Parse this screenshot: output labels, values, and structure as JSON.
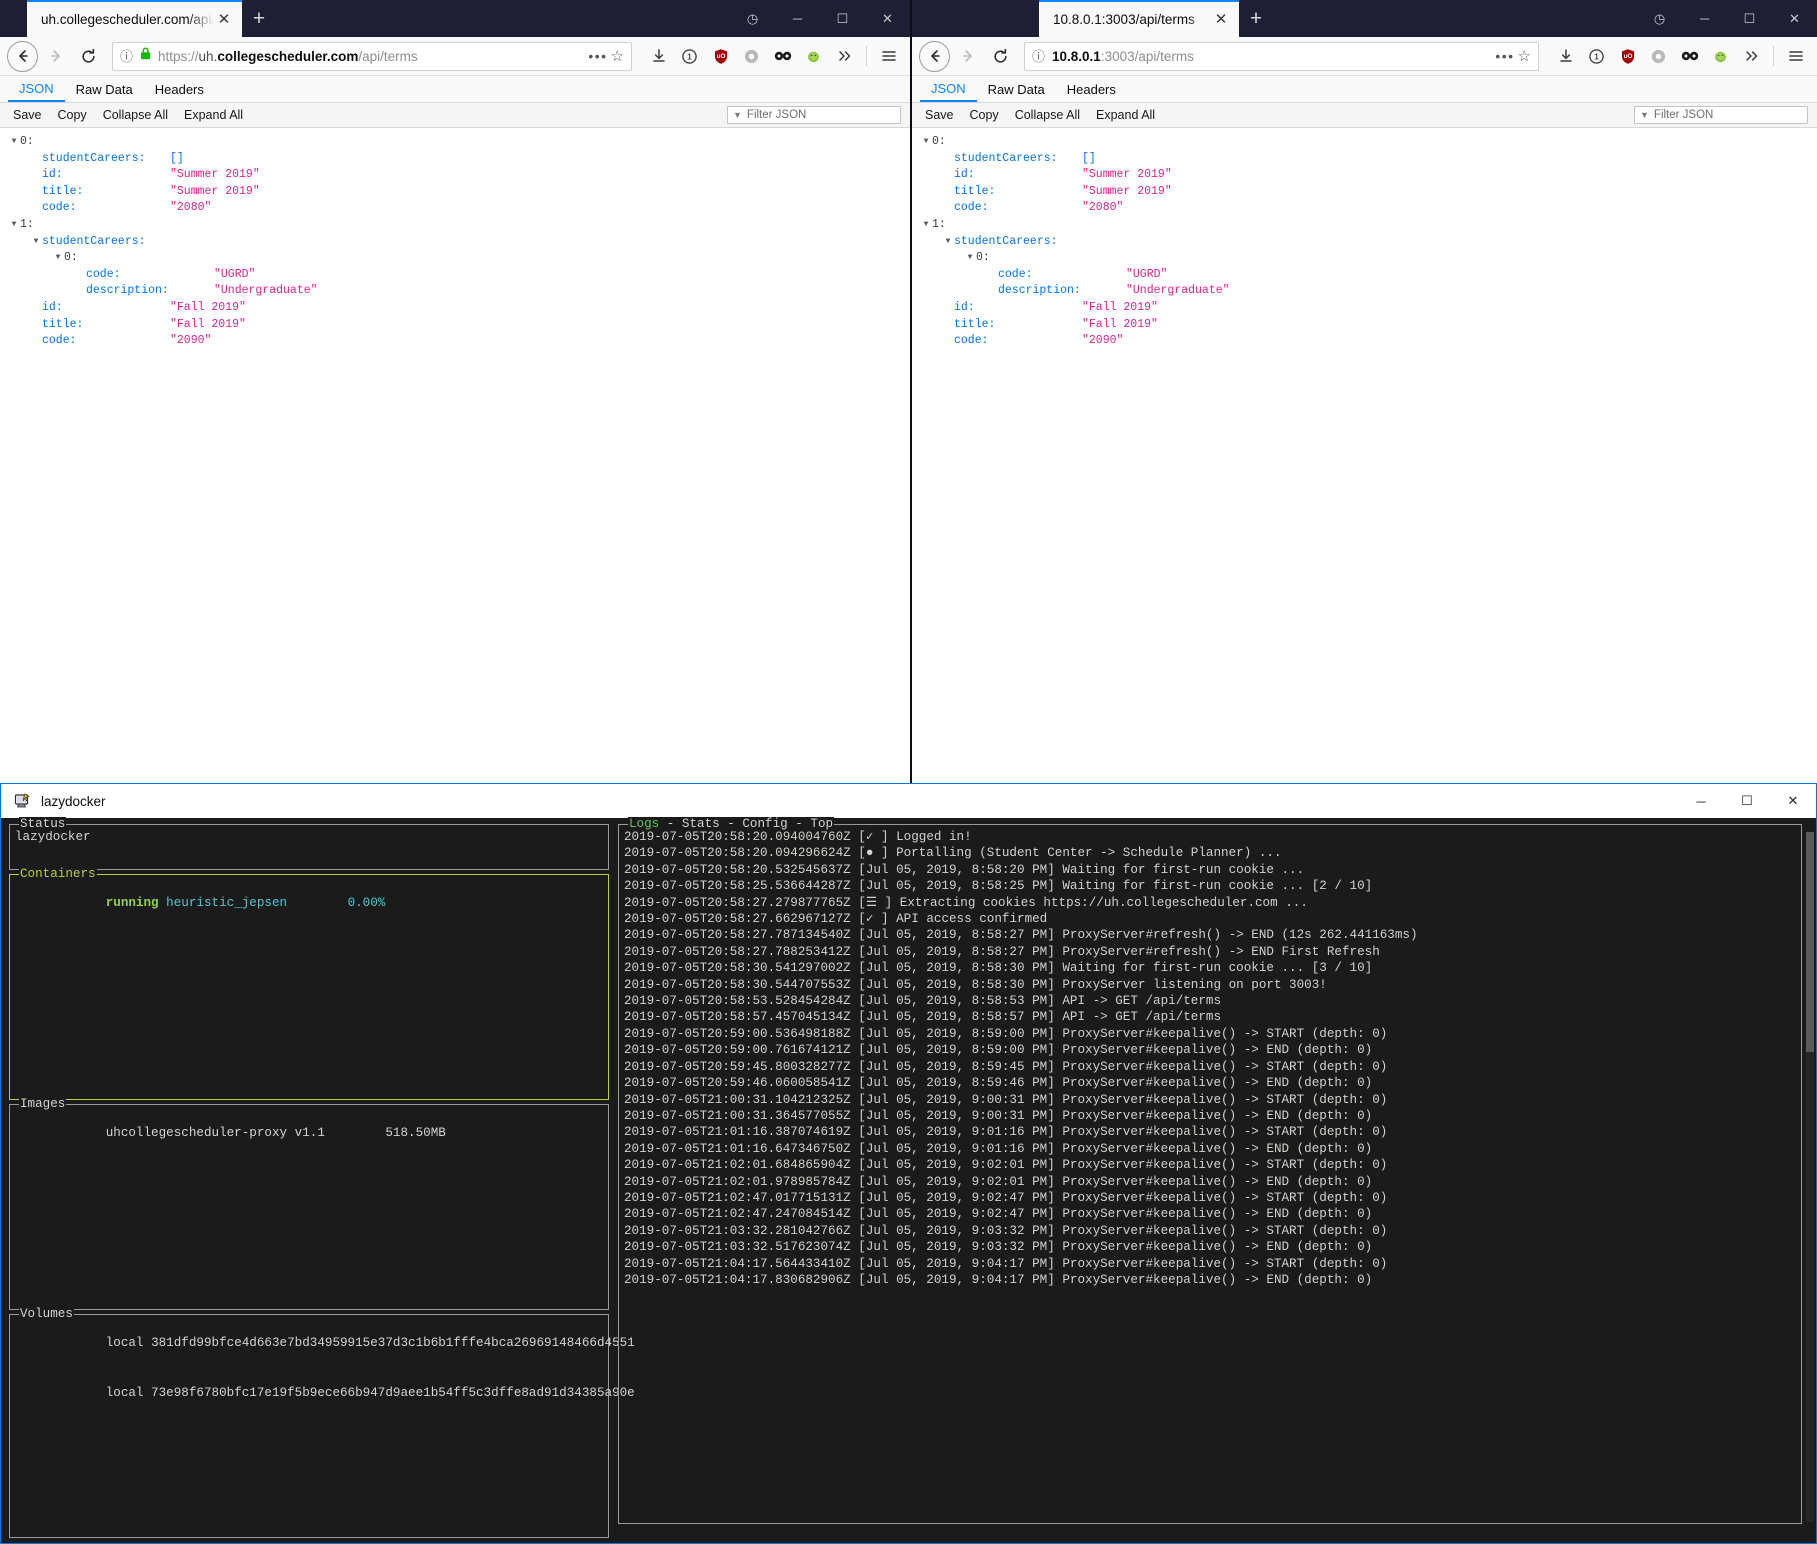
{
  "browser_left": {
    "tab": {
      "title": "uh.collegescheduler.com/api/terms",
      "close_label": "✕"
    },
    "new_tab_label": "+",
    "window_controls": {
      "clock": "◷",
      "minimize": "─",
      "maximize": "☐",
      "close": "✕"
    },
    "nav": {
      "back": "←",
      "forward": "→",
      "reload": "⟳"
    },
    "url": {
      "scheme": "https://",
      "host_dim": "uh.",
      "host_strong": "collegescheduler.com",
      "path": "/api/terms",
      "full": "https://uh.collegescheduler.com/api/terms"
    },
    "urlbar_icons": {
      "info": "ⓘ",
      "lock": "lock-icon",
      "more": "•••",
      "bookmark": "☆"
    },
    "toolbar_icons": [
      "download-icon",
      "pocket-icon",
      "ublock-origin-icon",
      "privacy-badger-icon",
      "cookie-autodelete-icon",
      "greenshot-icon",
      "overflow-icon",
      "hamburger-menu-icon"
    ],
    "json_tabs": [
      {
        "label": "JSON",
        "active": true
      },
      {
        "label": "Raw Data",
        "active": false
      },
      {
        "label": "Headers",
        "active": false
      }
    ],
    "json_toolbar": {
      "save": "Save",
      "copy": "Copy",
      "collapse_all": "Collapse All",
      "expand_all": "Expand All",
      "filter_placeholder": "Filter JSON",
      "filter_value": ""
    },
    "json_rows": [
      {
        "indent": 0,
        "twisty": "▼",
        "key": "0:",
        "key_type": "index",
        "value": ""
      },
      {
        "indent": 1,
        "twisty": "",
        "key": "studentCareers:",
        "key_type": "key",
        "value": "[]",
        "value_type": "empty"
      },
      {
        "indent": 1,
        "twisty": "",
        "key": "id:",
        "key_type": "key",
        "value": "\"Summer 2019\""
      },
      {
        "indent": 1,
        "twisty": "",
        "key": "title:",
        "key_type": "key",
        "value": "\"Summer 2019\""
      },
      {
        "indent": 1,
        "twisty": "",
        "key": "code:",
        "key_type": "key",
        "value": "\"2080\""
      },
      {
        "indent": 0,
        "twisty": "▼",
        "key": "1:",
        "key_type": "index",
        "value": ""
      },
      {
        "indent": 1,
        "twisty": "▼",
        "key": "studentCareers:",
        "key_type": "key",
        "value": ""
      },
      {
        "indent": 2,
        "twisty": "▼",
        "key": "0:",
        "key_type": "index",
        "value": ""
      },
      {
        "indent": 3,
        "twisty": "",
        "key": "code:",
        "key_type": "key",
        "value": "\"UGRD\""
      },
      {
        "indent": 3,
        "twisty": "",
        "key": "description:",
        "key_type": "key",
        "value": "\"Undergraduate\""
      },
      {
        "indent": 1,
        "twisty": "",
        "key": "id:",
        "key_type": "key",
        "value": "\"Fall 2019\""
      },
      {
        "indent": 1,
        "twisty": "",
        "key": "title:",
        "key_type": "key",
        "value": "\"Fall 2019\""
      },
      {
        "indent": 1,
        "twisty": "",
        "key": "code:",
        "key_type": "key",
        "value": "\"2090\""
      }
    ]
  },
  "browser_right": {
    "tab": {
      "title": "10.8.0.1:3003/api/terms",
      "close_label": "✕"
    },
    "new_tab_label": "+",
    "window_controls": {
      "clock": "◷",
      "minimize": "─",
      "maximize": "☐",
      "close": "✕"
    },
    "nav": {
      "back": "←",
      "forward": "→",
      "reload": "⟳"
    },
    "url": {
      "scheme": "",
      "host_dim": "",
      "host_strong": "10.8.0.1",
      "path": ":3003/api/terms",
      "full": "10.8.0.1:3003/api/terms"
    },
    "urlbar_icons": {
      "info": "ⓘ",
      "more": "•••",
      "bookmark": "☆"
    },
    "toolbar_icons": [
      "download-icon",
      "pocket-icon",
      "ublock-origin-icon",
      "privacy-badger-icon",
      "cookie-autodelete-icon",
      "greenshot-icon",
      "overflow-icon",
      "hamburger-menu-icon"
    ],
    "json_tabs": [
      {
        "label": "JSON",
        "active": true
      },
      {
        "label": "Raw Data",
        "active": false
      },
      {
        "label": "Headers",
        "active": false
      }
    ],
    "json_toolbar": {
      "save": "Save",
      "copy": "Copy",
      "collapse_all": "Collapse All",
      "expand_all": "Expand All",
      "filter_placeholder": "Filter JSON",
      "filter_value": ""
    },
    "json_rows": [
      {
        "indent": 0,
        "twisty": "▼",
        "key": "0:",
        "key_type": "index",
        "value": ""
      },
      {
        "indent": 1,
        "twisty": "",
        "key": "studentCareers:",
        "key_type": "key",
        "value": "[]",
        "value_type": "empty"
      },
      {
        "indent": 1,
        "twisty": "",
        "key": "id:",
        "key_type": "key",
        "value": "\"Summer 2019\""
      },
      {
        "indent": 1,
        "twisty": "",
        "key": "title:",
        "key_type": "key",
        "value": "\"Summer 2019\""
      },
      {
        "indent": 1,
        "twisty": "",
        "key": "code:",
        "key_type": "key",
        "value": "\"2080\""
      },
      {
        "indent": 0,
        "twisty": "▼",
        "key": "1:",
        "key_type": "index",
        "value": ""
      },
      {
        "indent": 1,
        "twisty": "▼",
        "key": "studentCareers:",
        "key_type": "key",
        "value": ""
      },
      {
        "indent": 2,
        "twisty": "▼",
        "key": "0:",
        "key_type": "index",
        "value": ""
      },
      {
        "indent": 3,
        "twisty": "",
        "key": "code:",
        "key_type": "key",
        "value": "\"UGRD\""
      },
      {
        "indent": 3,
        "twisty": "",
        "key": "description:",
        "key_type": "key",
        "value": "\"Undergraduate\""
      },
      {
        "indent": 1,
        "twisty": "",
        "key": "id:",
        "key_type": "key",
        "value": "\"Fall 2019\""
      },
      {
        "indent": 1,
        "twisty": "",
        "key": "title:",
        "key_type": "key",
        "value": "\"Fall 2019\""
      },
      {
        "indent": 1,
        "twisty": "",
        "key": "code:",
        "key_type": "key",
        "value": "\"2090\""
      }
    ]
  },
  "lazydocker": {
    "window_title": "lazydocker",
    "window_controls": {
      "minimize": "─",
      "maximize": "☐",
      "close": "✕"
    },
    "panels": {
      "status": {
        "legend": "Status",
        "lines": [
          "lazydocker"
        ]
      },
      "containers": {
        "legend": "Containers",
        "rows": [
          {
            "state": "running",
            "name": "heuristic_jepsen",
            "cpu": "0.00%"
          }
        ]
      },
      "images": {
        "legend": "Images",
        "rows": [
          {
            "name": "uhcollegescheduler-proxy v1.1",
            "size": "518.50MB"
          }
        ]
      },
      "volumes": {
        "legend": "Volumes",
        "rows": [
          {
            "driver": "local",
            "name": "381dfd99bfce4d663e7bd34959915e37d3c1b6b1fffe4bca26969148466d4551"
          },
          {
            "driver": "local",
            "name": "73e98f6780bfc17e19f5b9ece66b947d9aee1b54ff5c3dffe8ad91d34385a90e"
          }
        ]
      },
      "logs": {
        "legend_active": "Logs",
        "legend_rest": " - Stats - Config - Top",
        "lines": [
          "2019-07-05T20:58:20.094004760Z [✓ ] Logged in!",
          "2019-07-05T20:58:20.094296624Z [● ] Portalling (Student Center -> Schedule Planner) ...",
          "2019-07-05T20:58:20.532545637Z [Jul 05, 2019, 8:58:20 PM] Waiting for first-run cookie ...",
          "2019-07-05T20:58:25.536644287Z [Jul 05, 2019, 8:58:25 PM] Waiting for first-run cookie ... [2 / 10]",
          "2019-07-05T20:58:27.279877765Z [☰ ] Extracting cookies https://uh.collegescheduler.com ...",
          "2019-07-05T20:58:27.662967127Z [✓ ] API access confirmed",
          "2019-07-05T20:58:27.787134540Z [Jul 05, 2019, 8:58:27 PM] ProxyServer#refresh() -> END (12s 262.441163ms)",
          "2019-07-05T20:58:27.788253412Z [Jul 05, 2019, 8:58:27 PM] ProxyServer#refresh() -> END First Refresh",
          "2019-07-05T20:58:30.541297002Z [Jul 05, 2019, 8:58:30 PM] Waiting for first-run cookie ... [3 / 10]",
          "2019-07-05T20:58:30.544707553Z [Jul 05, 2019, 8:58:30 PM] ProxyServer listening on port 3003!",
          "2019-07-05T20:58:53.528454284Z [Jul 05, 2019, 8:58:53 PM] API -> GET /api/terms",
          "2019-07-05T20:58:57.457045134Z [Jul 05, 2019, 8:58:57 PM] API -> GET /api/terms",
          "2019-07-05T20:59:00.536498188Z [Jul 05, 2019, 8:59:00 PM] ProxyServer#keepalive() -> START (depth: 0)",
          "2019-07-05T20:59:00.761674121Z [Jul 05, 2019, 8:59:00 PM] ProxyServer#keepalive() -> END (depth: 0)",
          "2019-07-05T20:59:45.800328277Z [Jul 05, 2019, 8:59:45 PM] ProxyServer#keepalive() -> START (depth: 0)",
          "2019-07-05T20:59:46.060058541Z [Jul 05, 2019, 8:59:46 PM] ProxyServer#keepalive() -> END (depth: 0)",
          "2019-07-05T21:00:31.104212325Z [Jul 05, 2019, 9:00:31 PM] ProxyServer#keepalive() -> START (depth: 0)",
          "2019-07-05T21:00:31.364577055Z [Jul 05, 2019, 9:00:31 PM] ProxyServer#keepalive() -> END (depth: 0)",
          "2019-07-05T21:01:16.387074619Z [Jul 05, 2019, 9:01:16 PM] ProxyServer#keepalive() -> START (depth: 0)",
          "2019-07-05T21:01:16.647346750Z [Jul 05, 2019, 9:01:16 PM] ProxyServer#keepalive() -> END (depth: 0)",
          "2019-07-05T21:02:01.684865904Z [Jul 05, 2019, 9:02:01 PM] ProxyServer#keepalive() -> START (depth: 0)",
          "2019-07-05T21:02:01.978985784Z [Jul 05, 2019, 9:02:01 PM] ProxyServer#keepalive() -> END (depth: 0)",
          "2019-07-05T21:02:47.017715131Z [Jul 05, 2019, 9:02:47 PM] ProxyServer#keepalive() -> START (depth: 0)",
          "2019-07-05T21:02:47.247084514Z [Jul 05, 2019, 9:02:47 PM] ProxyServer#keepalive() -> END (depth: 0)",
          "2019-07-05T21:03:32.281042766Z [Jul 05, 2019, 9:03:32 PM] ProxyServer#keepalive() -> START (depth: 0)",
          "2019-07-05T21:03:32.517623074Z [Jul 05, 2019, 9:03:32 PM] ProxyServer#keepalive() -> END (depth: 0)",
          "2019-07-05T21:04:17.564433410Z [Jul 05, 2019, 9:04:17 PM] ProxyServer#keepalive() -> START (depth: 0)",
          "2019-07-05T21:04:17.830682906Z [Jul 05, 2019, 9:04:17 PM] ProxyServer#keepalive() -> END (depth: 0)"
        ]
      }
    }
  },
  "colors": {
    "firefox_chrome": "#1e1e35",
    "accent_blue": "#0a84ff",
    "json_key": "#0074e8",
    "json_string": "#e0218a",
    "lazydocker_bg": "#1b1b1b",
    "lazydocker_accent": "#b5d334",
    "lazydocker_running": "#8fd34f",
    "win_border_blue": "#0078d7"
  }
}
